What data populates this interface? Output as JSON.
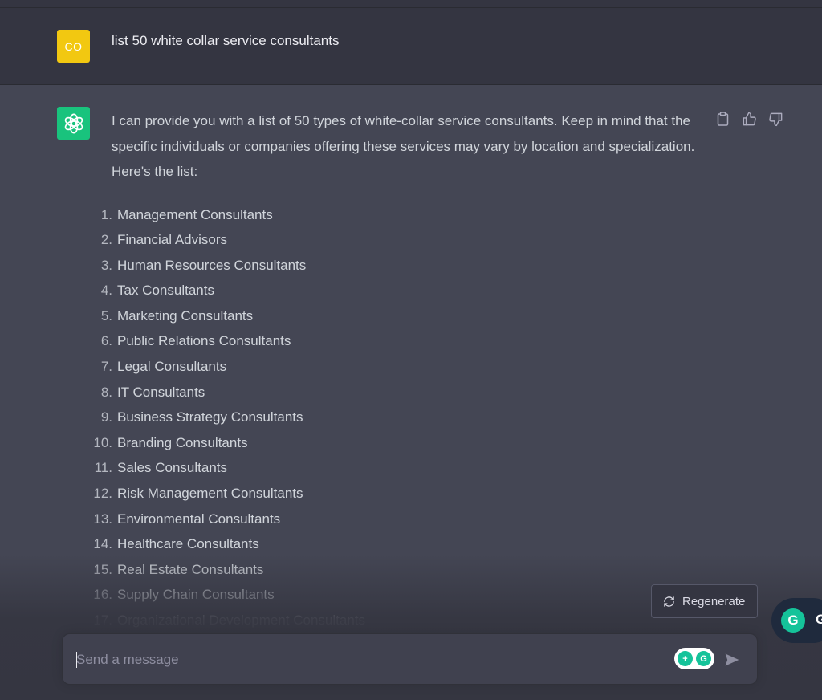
{
  "user_message": {
    "avatar_initials": "CO",
    "text": "list 50 white collar service consultants",
    "avatar_color": "#f2c811"
  },
  "assistant_message": {
    "avatar_icon": "openai-logo-icon",
    "avatar_color": "#19c37d",
    "intro": "I can provide you with a list of 50 types of white-collar service consultants. Keep in mind that the specific individuals or companies offering these services may vary by location and specialization. Here's the list:",
    "items": [
      {
        "num": "1.",
        "label": "Management Consultants"
      },
      {
        "num": "2.",
        "label": "Financial Advisors"
      },
      {
        "num": "3.",
        "label": "Human Resources Consultants"
      },
      {
        "num": "4.",
        "label": "Tax Consultants"
      },
      {
        "num": "5.",
        "label": "Marketing Consultants"
      },
      {
        "num": "6.",
        "label": "Public Relations Consultants"
      },
      {
        "num": "7.",
        "label": "Legal Consultants"
      },
      {
        "num": "8.",
        "label": "IT Consultants"
      },
      {
        "num": "9.",
        "label": "Business Strategy Consultants"
      },
      {
        "num": "10.",
        "label": "Branding Consultants"
      },
      {
        "num": "11.",
        "label": "Sales Consultants"
      },
      {
        "num": "12.",
        "label": "Risk Management Consultants"
      },
      {
        "num": "13.",
        "label": "Environmental Consultants"
      },
      {
        "num": "14.",
        "label": "Healthcare Consultants"
      },
      {
        "num": "15.",
        "label": "Real Estate Consultants"
      },
      {
        "num": "16.",
        "label": "Supply Chain Consultants"
      },
      {
        "num": "17.",
        "label": "Organizational Development Consultants"
      }
    ],
    "actions": [
      "copy-icon",
      "thumbs-up-icon",
      "thumbs-down-icon"
    ]
  },
  "regenerate": {
    "label": "Regenerate",
    "icon": "refresh-icon"
  },
  "grammarly": {
    "letter": "G",
    "color": "#15c39a"
  },
  "composer": {
    "placeholder": "Send a message",
    "value": "",
    "send_icon": "send-icon"
  }
}
